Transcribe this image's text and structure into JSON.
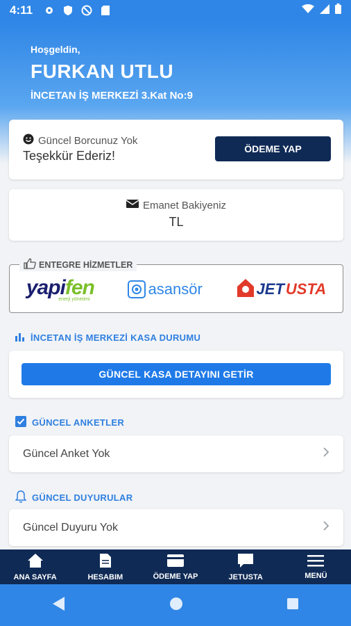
{
  "status_bar": {
    "time": "4:11"
  },
  "header": {
    "greeting": "Hoşgeldin,",
    "user_name": "FURKAN UTLU",
    "address": "İNCETAN İŞ MERKEZİ 3.Kat No:9"
  },
  "debt_card": {
    "status_label": "Güncel Borcunuz Yok",
    "message": "Teşekkür Ederiz!",
    "pay_button": "ÖDEME YAP"
  },
  "balance_card": {
    "label": "Emanet Bakiyeniz",
    "value": "TL"
  },
  "integrated_services": {
    "title": "ENTEGRE HİZMETLER",
    "yapifen": {
      "main": "yapi",
      "accent": "fen",
      "tagline": "enerji yönetimi"
    },
    "asansor": {
      "text": "asansör"
    },
    "jetusta": {
      "jet": "JET",
      "usta": "USTA"
    }
  },
  "kasa": {
    "section_title": "İNCETAN İŞ MERKEZİ KASA DURUMU",
    "button": "GÜNCEL KASA DETAYINI GETİR"
  },
  "surveys": {
    "section_title": "GÜNCEL ANKETLER",
    "row_text": "Güncel Anket Yok"
  },
  "announcements": {
    "section_title": "GÜNCEL DUYURULAR",
    "row_text": "Güncel Duyuru Yok"
  },
  "bottom_nav": {
    "items": [
      {
        "label": "ANA SAYFA",
        "icon": "home-icon"
      },
      {
        "label": "HESABIM",
        "icon": "document-icon"
      },
      {
        "label": "ÖDEME YAP",
        "icon": "card-icon"
      },
      {
        "label": "JETUSTA",
        "icon": "chat-icon"
      },
      {
        "label": "MENÜ",
        "icon": "menu-icon"
      }
    ]
  },
  "colors": {
    "primary": "#2f86e6",
    "navy": "#0f2a55",
    "accent_blue": "#1f7ae8"
  }
}
